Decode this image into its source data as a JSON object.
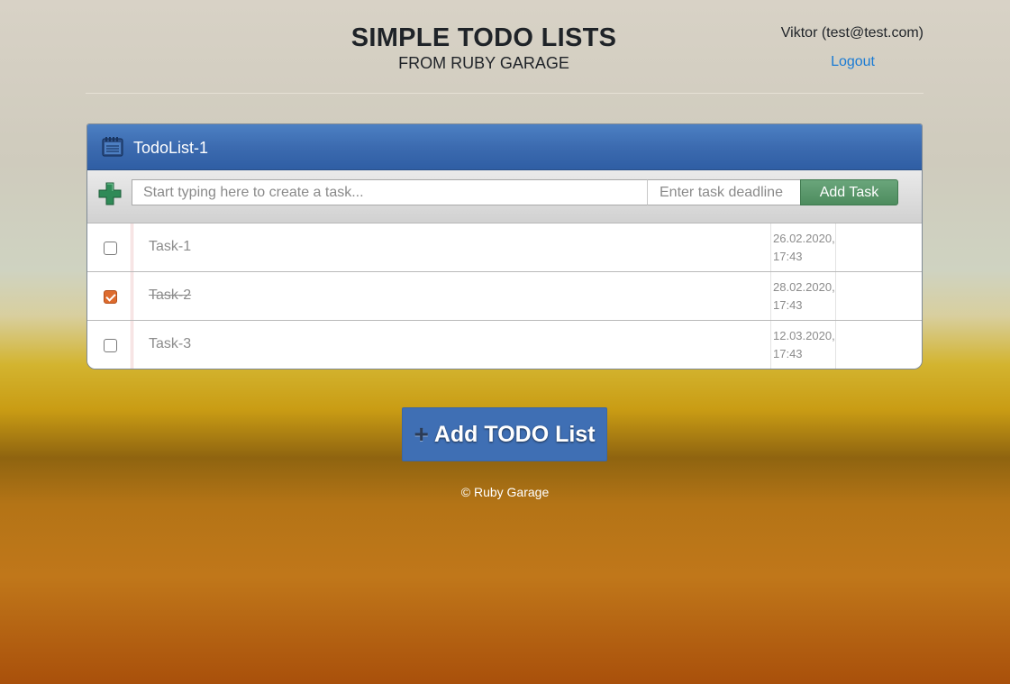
{
  "header": {
    "title": "SIMPLE TODO LISTS",
    "subtitle": "FROM RUBY GARAGE",
    "user": "Viktor (test@test.com)",
    "logout_label": "Logout"
  },
  "todo_list": {
    "title": "TodoList-1",
    "task_placeholder": "Start typing here to create a task...",
    "deadline_placeholder": "Enter task deadline",
    "add_task_label": "Add Task",
    "tasks": [
      {
        "name": "Task-1",
        "done": false,
        "deadline": "26.02.2020,\n17:43"
      },
      {
        "name": "Task-2",
        "done": true,
        "deadline": "28.02.2020,\n17:43"
      },
      {
        "name": "Task-3",
        "done": false,
        "deadline": "12.03.2020,\n17:43"
      }
    ]
  },
  "add_list_button": {
    "icon": "plus-icon",
    "label": "Add TODO List"
  },
  "footer": {
    "text": "© Ruby Garage"
  },
  "colors": {
    "accent_blue": "#3f6fb4",
    "add_task_green": "#4d8c5e",
    "checked_orange": "#dd6b2e",
    "link_blue": "#1a7bd4"
  }
}
